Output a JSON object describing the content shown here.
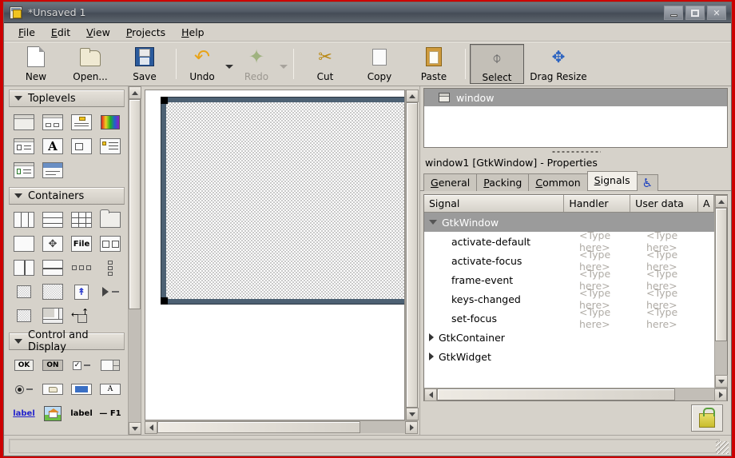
{
  "window": {
    "title": "*Unsaved 1",
    "icon": "glade-app-icon",
    "controls": [
      {
        "name": "minimize-button",
        "glyph": "minimize"
      },
      {
        "name": "maximize-button",
        "glyph": "maximize"
      },
      {
        "name": "close-button",
        "glyph": "✕"
      }
    ]
  },
  "menubar": {
    "items": [
      {
        "pre": "",
        "key": "F",
        "post": "ile"
      },
      {
        "pre": "",
        "key": "E",
        "post": "dit"
      },
      {
        "pre": "",
        "key": "V",
        "post": "iew"
      },
      {
        "pre": "",
        "key": "P",
        "post": "rojects"
      },
      {
        "pre": "",
        "key": "H",
        "post": "elp"
      }
    ]
  },
  "toolbar": {
    "items": [
      {
        "label": "New",
        "icon": "new-document-icon",
        "disabled": false,
        "arrow": false,
        "active": false
      },
      {
        "label": "Open...",
        "icon": "open-folder-icon",
        "disabled": false,
        "arrow": false,
        "active": false
      },
      {
        "label": "Save",
        "icon": "save-floppy-icon",
        "disabled": false,
        "arrow": false,
        "active": false
      },
      {
        "label": "Undo",
        "icon": "undo-arrow-icon",
        "disabled": false,
        "arrow": true,
        "active": false
      },
      {
        "label": "Redo",
        "icon": "redo-arrow-icon",
        "disabled": true,
        "arrow": true,
        "active": false
      },
      {
        "label": "Cut",
        "icon": "scissors-icon",
        "disabled": false,
        "arrow": false,
        "active": false
      },
      {
        "label": "Copy",
        "icon": "copy-pages-icon",
        "disabled": false,
        "arrow": false,
        "active": false
      },
      {
        "label": "Paste",
        "icon": "clipboard-icon",
        "disabled": false,
        "arrow": false,
        "active": false
      },
      {
        "label": "Select",
        "icon": "mouse-pointer-icon",
        "disabled": false,
        "arrow": false,
        "active": true
      },
      {
        "label": "Drag Resize",
        "icon": "move-arrows-icon",
        "disabled": false,
        "arrow": false,
        "active": false
      }
    ]
  },
  "palette": {
    "sections": [
      {
        "title": "Toplevels",
        "expanded": true,
        "widgets": [
          "window-widget-icon",
          "dialog-widget-icon",
          "message-dialog-icon",
          "color-selection-dialog-icon",
          "file-chooser-dialog-icon",
          "font-selection-dialog-icon",
          "about-dialog-icon",
          "assistant-icon",
          "recent-chooser-dialog-icon",
          "offscreen-window-icon"
        ]
      },
      {
        "title": "Containers",
        "expanded": true,
        "widgets": [
          "hbox-icon",
          "vbox-icon",
          "table-icon",
          "notebook-icon",
          "frame-icon",
          "alignment-icon",
          "file-chooser-widget-icon",
          "hbutton-box-icon",
          "hpaned-icon",
          "vpaned-icon",
          "toolbar-icon",
          "toolpalette-icon",
          "scrolled-window-icon",
          "viewport-icon",
          "event-box-icon",
          "expander-icon",
          "fixed-icon",
          "layout-icon",
          "handle-box-icon"
        ]
      },
      {
        "title": "Control and Display",
        "expanded": true,
        "widgets": [
          "button-icon",
          "toggle-button-icon",
          "check-button-icon",
          "spin-button-icon",
          "radio-button-icon",
          "file-chooser-button-icon",
          "color-button-icon",
          "font-button-icon",
          "link-button-icon",
          "image-icon",
          "label-icon",
          "accel-label-icon"
        ]
      }
    ],
    "widget_glyphs": {
      "button-icon": "OK",
      "toggle-button-icon": "ON",
      "link-button-icon": "label",
      "label-icon": "label",
      "accel-label-icon": "— F1",
      "file-chooser-widget-icon": "File"
    }
  },
  "canvas": {
    "design_window_name": "window1",
    "selected": true,
    "selection_border_color": "#4d6173",
    "handle_color": "#000000"
  },
  "inspector": {
    "tree": [
      {
        "label": "window",
        "icon": "window-icon",
        "selected": true
      }
    ]
  },
  "properties": {
    "title": "window1 [GtkWindow] - Properties",
    "tabs": [
      {
        "pre": "",
        "key": "G",
        "post": "eneral",
        "active": false,
        "name": "tab-general"
      },
      {
        "pre": "",
        "key": "P",
        "post": "acking",
        "active": false,
        "name": "tab-packing"
      },
      {
        "pre": "",
        "key": "C",
        "post": "ommon",
        "active": false,
        "name": "tab-common"
      },
      {
        "pre": "",
        "key": "S",
        "post": "ignals",
        "active": true,
        "name": "tab-signals"
      },
      {
        "icon": "accessibility-icon",
        "active": false,
        "name": "tab-accessibility"
      }
    ]
  },
  "signals": {
    "columns": [
      "Signal",
      "Handler",
      "User data",
      "A"
    ],
    "placeholder": "<Type here>",
    "rows": [
      {
        "type": "group",
        "label": "GtkWindow",
        "expanded": true
      },
      {
        "type": "signal",
        "label": "activate-default",
        "handler": "<Type here>",
        "user_data": "<Type here>"
      },
      {
        "type": "signal",
        "label": "activate-focus",
        "handler": "<Type here>",
        "user_data": "<Type here>"
      },
      {
        "type": "signal",
        "label": "frame-event",
        "handler": "<Type here>",
        "user_data": "<Type here>"
      },
      {
        "type": "signal",
        "label": "keys-changed",
        "handler": "<Type here>",
        "user_data": "<Type here>"
      },
      {
        "type": "signal",
        "label": "set-focus",
        "handler": "<Type here>",
        "user_data": "<Type here>"
      },
      {
        "type": "group",
        "label": "GtkContainer",
        "expanded": false
      },
      {
        "type": "group",
        "label": "GtkWidget",
        "expanded": false
      }
    ]
  },
  "footer": {
    "lock_button": "lock-icon",
    "status_text": ""
  }
}
